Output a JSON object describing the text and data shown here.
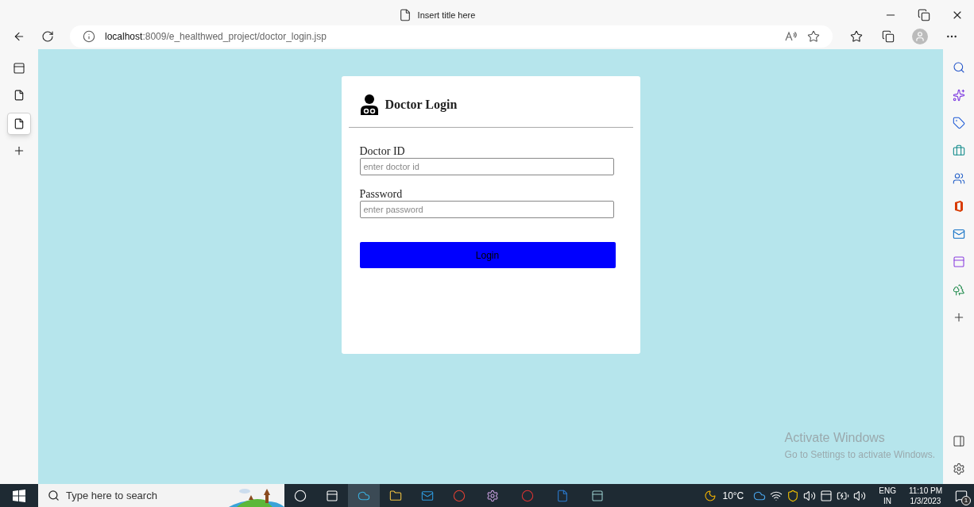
{
  "window": {
    "title": "Insert title here"
  },
  "browser": {
    "url": {
      "host": "localhost",
      "path": ":8009/e_healthwed_project/doctor_login.jsp"
    },
    "tabs": [
      {
        "selected": false
      },
      {
        "selected": true
      }
    ]
  },
  "login_card": {
    "title": "Doctor Login",
    "fields": [
      {
        "label": "Doctor ID",
        "placeholder": "enter doctor id"
      },
      {
        "label": "Password",
        "placeholder": "enter password"
      }
    ],
    "button": "Login"
  },
  "activation_notice": {
    "title": "Activate Windows",
    "subtitle": "Go to Settings to activate Windows."
  },
  "taskbar": {
    "search": {
      "placeholder": "Type here to search"
    },
    "weather": "10°C",
    "language": [
      "ENG",
      "IN"
    ],
    "clock": {
      "time": "11:10 PM",
      "date": "1/3/2023"
    },
    "notifications": "1"
  }
}
